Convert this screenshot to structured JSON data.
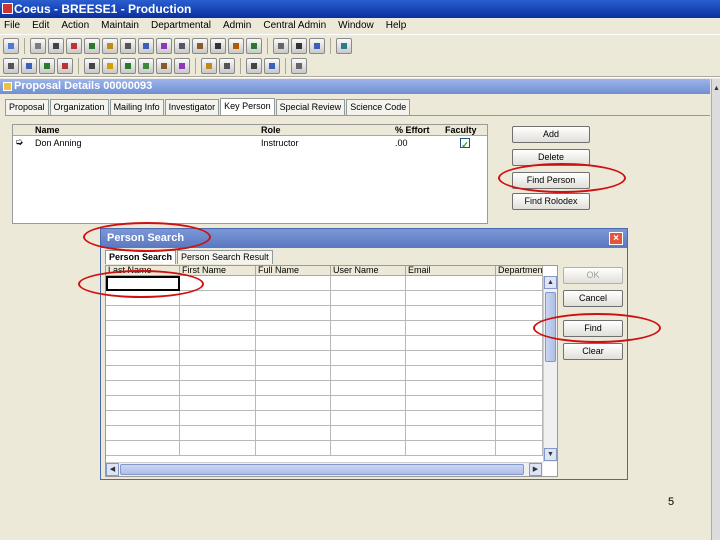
{
  "app": {
    "title": "Coeus - BREESE1 - Production"
  },
  "menu": [
    "File",
    "Edit",
    "Action",
    "Maintain",
    "Departmental",
    "Admin",
    "Central Admin",
    "Window",
    "Help"
  ],
  "proposal_window": {
    "title": "Proposal Details 00000093",
    "tabs": [
      "Proposal",
      "Organization",
      "Mailing Info",
      "Investigator",
      "Key Person",
      "Special Review",
      "Science Code"
    ],
    "active_tab": "Key Person"
  },
  "key_persons": {
    "columns": [
      "Name",
      "Role",
      "% Effort",
      "Faculty"
    ],
    "rows": [
      {
        "name": "Don Anning",
        "role": "Instructor",
        "effort": ".00",
        "faculty": true
      }
    ],
    "buttons": {
      "add": "Add",
      "delete": "Delete",
      "find_person": "Find Person",
      "find_rolodex": "Find Rolodex"
    }
  },
  "person_search_dialog": {
    "title": "Person Search",
    "close_glyph": "×",
    "tabs": [
      "Person Search",
      "Person Search Result"
    ],
    "active_tab": "Person Search",
    "columns": [
      "Last Name",
      "First Name",
      "Full Name",
      "User Name",
      "Email",
      "Departmen"
    ],
    "buttons": {
      "ok": "OK",
      "cancel": "Cancel",
      "find": "Find",
      "clear": "Clear"
    }
  },
  "page_number": "5",
  "colors": {
    "annotation": "#d01010",
    "titlebar": "#0a2f9e"
  }
}
